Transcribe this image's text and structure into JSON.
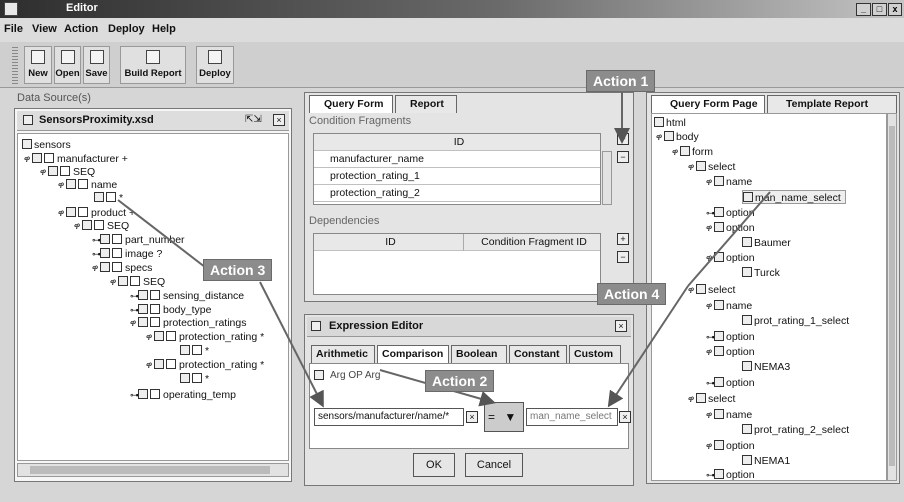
{
  "window": {
    "title": "Editor"
  },
  "menu": [
    "File",
    "View",
    "Action",
    "Deploy",
    "Help"
  ],
  "toolbar": {
    "new": "New",
    "open": "Open",
    "save": "Save",
    "build_report": "Build Report",
    "deploy": "Deploy"
  },
  "datasource": {
    "panel_label": "Data Source(s)",
    "file": "SensorsProximity.xsd",
    "tree": [
      "sensors",
      "manufacturer +",
      "SEQ",
      "name",
      "*",
      "product +",
      "SEQ",
      "part_number",
      "image ?",
      "specs",
      "SEQ",
      "sensing_distance",
      "body_type",
      "protection_ratings",
      "protection_rating *",
      "*",
      "protection_rating *",
      "*",
      "operating_temp"
    ]
  },
  "query": {
    "tabs": [
      "Query Form",
      "Report"
    ],
    "fragments_label": "Condition Fragments",
    "fragments_header": "ID",
    "fragments": [
      "manufacturer_name",
      "protection_rating_1",
      "protection_rating_2"
    ],
    "dependencies_label": "Dependencies",
    "dep_headers": [
      "ID",
      "Condition Fragment ID"
    ]
  },
  "expr": {
    "title": "Expression Editor",
    "tabs": [
      "Arithmetic",
      "Comparison",
      "Boolean",
      "Constant",
      "Custom"
    ],
    "arg_label": "Arg OP Arg",
    "left": "sensors/manufacturer/name/*",
    "op": "=",
    "right": "man_name_select",
    "ok": "OK",
    "cancel": "Cancel"
  },
  "page": {
    "tabs": [
      "Query Form Page",
      "Template Report Page"
    ],
    "tree": [
      "html",
      "body",
      "form",
      "select",
      "name",
      "man_name_select",
      "option",
      "option",
      "Baumer",
      "option",
      "Turck",
      "select",
      "name",
      "prot_rating_1_select",
      "option",
      "option",
      "NEMA3",
      "option",
      "select",
      "name",
      "prot_rating_2_select",
      "option",
      "NEMA1",
      "option"
    ]
  },
  "annotations": {
    "a1": "Action 1",
    "a2": "Action 2",
    "a3": "Action 3",
    "a4": "Action 4"
  }
}
